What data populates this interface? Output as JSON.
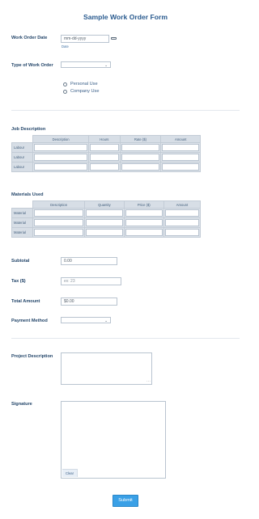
{
  "form": {
    "title": "Sample Work Order Form",
    "work_order_date": {
      "label": "Work Order Date",
      "placeholder": "mm-dd-yyyy",
      "sublabel": "Date"
    },
    "type_of_work_order": {
      "label": "Type of Work Order",
      "value": "",
      "options": [
        "Personal Use",
        "Company Use"
      ]
    },
    "job_description": {
      "label": "Job Description",
      "columns": [
        "Description",
        "Hours",
        "Rate ($)",
        "Amount"
      ],
      "rows": [
        "Labour",
        "Labour",
        "Labour"
      ]
    },
    "materials_used": {
      "label": "Materials Used",
      "columns": [
        "Description",
        "Quantity",
        "Price ($)",
        "Amount"
      ],
      "rows": [
        "Material",
        "Material",
        "Material"
      ]
    },
    "subtotal": {
      "label": "Subtotal",
      "value": "0.00"
    },
    "tax": {
      "label": "Tax ($)",
      "placeholder": "ex: 23"
    },
    "total_amount": {
      "label": "Total Amount",
      "value": "$0.00"
    },
    "payment_method": {
      "label": "Payment Method",
      "value": ""
    },
    "project_description": {
      "label": "Project Description"
    },
    "signature": {
      "label": "Signature",
      "clear_label": "Clear"
    },
    "submit_label": "Submit"
  },
  "icons": {
    "calendar": "calendar-icon",
    "chevron": "chevron-down-icon",
    "radio": "radio-icon"
  },
  "colors": {
    "accent": "#3aa0e6",
    "title": "#2a5b8f",
    "label": "#24466a",
    "border": "#b9c4d0"
  }
}
